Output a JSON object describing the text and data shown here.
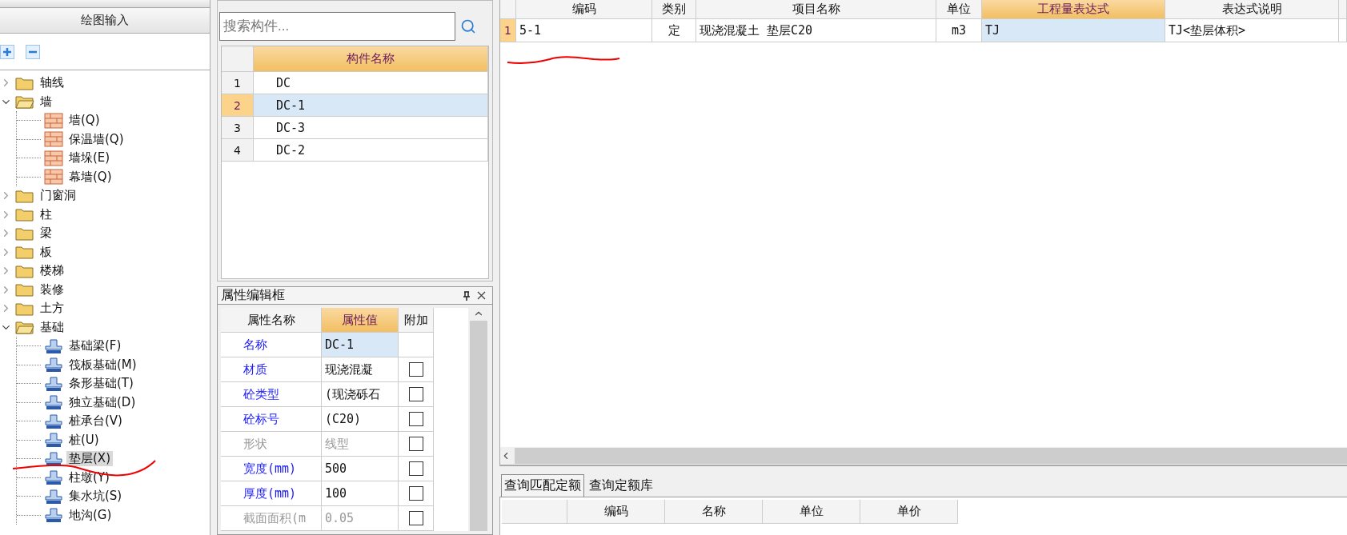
{
  "left_panel": {
    "tab": "绘图输入",
    "tree": [
      {
        "label": "轴线",
        "expanded": false,
        "selected": false
      },
      {
        "label": "墙",
        "expanded": true,
        "selected": false,
        "children": [
          {
            "label": "墙(Q)",
            "kind": "wall",
            "selected": false
          },
          {
            "label": "保温墙(Q)",
            "kind": "wall",
            "selected": false
          },
          {
            "label": "墙垛(E)",
            "kind": "wall",
            "selected": false
          },
          {
            "label": "幕墙(Q)",
            "kind": "wall",
            "selected": false
          }
        ]
      },
      {
        "label": "门窗洞",
        "expanded": false,
        "selected": false
      },
      {
        "label": "柱",
        "expanded": false,
        "selected": false
      },
      {
        "label": "梁",
        "expanded": false,
        "selected": false
      },
      {
        "label": "板",
        "expanded": false,
        "selected": false
      },
      {
        "label": "楼梯",
        "expanded": false,
        "selected": false
      },
      {
        "label": "装修",
        "expanded": false,
        "selected": false
      },
      {
        "label": "土方",
        "expanded": false,
        "selected": false
      },
      {
        "label": "基础",
        "expanded": true,
        "selected": false,
        "children": [
          {
            "label": "基础梁(F)",
            "kind": "foundation",
            "selected": false
          },
          {
            "label": "筏板基础(M)",
            "kind": "foundation",
            "selected": false
          },
          {
            "label": "条形基础(T)",
            "kind": "foundation",
            "selected": false
          },
          {
            "label": "独立基础(D)",
            "kind": "foundation",
            "selected": false
          },
          {
            "label": "桩承台(V)",
            "kind": "foundation",
            "selected": false
          },
          {
            "label": "桩(U)",
            "kind": "foundation",
            "selected": false
          },
          {
            "label": "垫层(X)",
            "kind": "foundation",
            "selected": true
          },
          {
            "label": "柱墩(Y)",
            "kind": "foundation",
            "selected": false
          },
          {
            "label": "集水坑(S)",
            "kind": "foundation",
            "selected": false
          },
          {
            "label": "地沟(G)",
            "kind": "foundation",
            "selected": false
          }
        ]
      }
    ]
  },
  "component_list": {
    "search": {
      "placeholder": "搜索构件..."
    },
    "column": "构件名称",
    "rows": [
      {
        "num": "1",
        "name": "DC",
        "selected": false
      },
      {
        "num": "2",
        "name": "DC-1",
        "selected": true
      },
      {
        "num": "3",
        "name": "DC-3",
        "selected": false
      },
      {
        "num": "4",
        "name": "DC-2",
        "selected": false
      }
    ]
  },
  "properties": {
    "title": "属性编辑框",
    "columns": [
      "属性名称",
      "属性值",
      "附加"
    ],
    "rows": [
      {
        "name": "名称",
        "value": "DC-1",
        "kind": "plain",
        "disabled": false,
        "selected": true
      },
      {
        "name": "材质",
        "value": "现浇混凝",
        "kind": "checkbox",
        "checked": false,
        "disabled": false,
        "selected": false
      },
      {
        "name": "砼类型",
        "value": "(现浇砾石",
        "kind": "checkbox",
        "checked": false,
        "disabled": false,
        "selected": false
      },
      {
        "name": "砼标号",
        "value": "(C20)",
        "kind": "checkbox",
        "checked": false,
        "disabled": false,
        "selected": false
      },
      {
        "name": "形状",
        "value": "线型",
        "kind": "checkbox",
        "checked": false,
        "disabled": true,
        "selected": false
      },
      {
        "name": "宽度(mm)",
        "value": "500",
        "kind": "checkbox",
        "checked": false,
        "disabled": false,
        "selected": false
      },
      {
        "name": "厚度(mm)",
        "value": "100",
        "kind": "checkbox",
        "checked": false,
        "disabled": false,
        "selected": false
      },
      {
        "name": "截面面积(m",
        "value": "0.05",
        "kind": "checkbox",
        "checked": false,
        "disabled": true,
        "selected": false
      }
    ]
  },
  "quota_table": {
    "columns": [
      {
        "label": "编码",
        "selected": false
      },
      {
        "label": "类别",
        "selected": false
      },
      {
        "label": "项目名称",
        "selected": false
      },
      {
        "label": "单位",
        "selected": false
      },
      {
        "label": "工程量表达式",
        "selected": true
      },
      {
        "label": "表达式说明",
        "selected": false
      }
    ],
    "rows": [
      {
        "num": "1",
        "selected": true,
        "cells": [
          "5-1",
          "定",
          "现浇混凝土 垫层C20",
          "m3",
          "TJ",
          "TJ<垫层体积>"
        ]
      }
    ]
  },
  "lookup": {
    "tabs": [
      {
        "label": "查询匹配定额",
        "selected": true
      },
      {
        "label": "查询定额库",
        "selected": false
      }
    ],
    "columns": [
      "编码",
      "名称",
      "单位",
      "单价"
    ]
  }
}
